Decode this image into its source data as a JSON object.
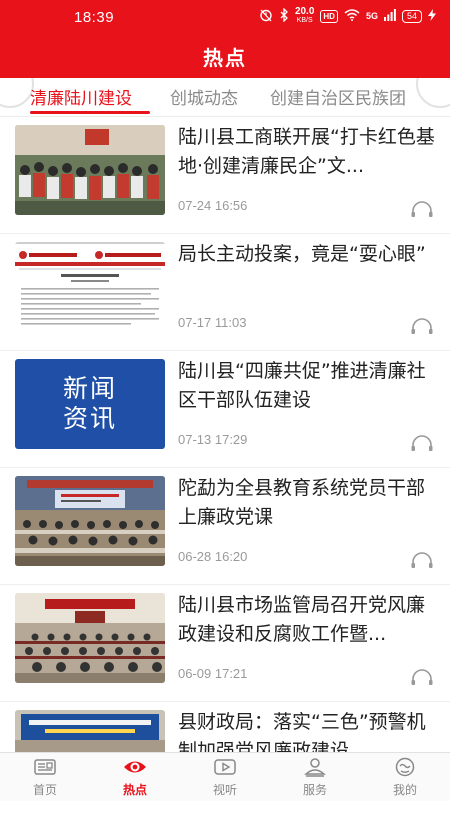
{
  "status_bar": {
    "time": "18:39",
    "net_speed": "20.0",
    "net_unit": "KB/S",
    "hd": "HD",
    "signal": "5G",
    "battery": "54"
  },
  "header": {
    "title": "热点"
  },
  "tabs": [
    {
      "label": "清廉陆川建设",
      "active": true
    },
    {
      "label": "创城动态",
      "active": false
    },
    {
      "label": "创建自治区民族团",
      "active": false
    }
  ],
  "news": [
    {
      "title": "陆川县工商联开展“打卡红色基地·创建清廉民企”文...",
      "time": "07-24 16:56",
      "thumb": "meeting-photo"
    },
    {
      "title": "局长主动投案，竟是“耍心眼”",
      "time": "07-17 11:03",
      "thumb": "document-screenshot"
    },
    {
      "title": "陆川县“四廉共促”推进清廉社区干部队伍建设",
      "time": "07-13 17:29",
      "thumb": "news-text-card",
      "thumb_text_1": "新闻",
      "thumb_text_2": "资讯"
    },
    {
      "title": "陀勐为全县教育系统党员干部上廉政党课",
      "time": "06-28 16:20",
      "thumb": "lecture-hall-photo"
    },
    {
      "title": "陆川县市场监管局召开党风廉政建设和反腐败工作暨...",
      "time": "06-09 17:21",
      "thumb": "conference-photo"
    },
    {
      "title": "县财政局：落实“三色”预警机制加强党风廉政建设",
      "time": "",
      "thumb": "stage-photo"
    }
  ],
  "bottom_nav": [
    {
      "label": "首页",
      "icon": "newspaper-icon",
      "active": false
    },
    {
      "label": "热点",
      "icon": "eye-icon",
      "active": true
    },
    {
      "label": "视听",
      "icon": "video-icon",
      "active": false
    },
    {
      "label": "服务",
      "icon": "service-icon",
      "active": false
    },
    {
      "label": "我的",
      "icon": "profile-icon",
      "active": false
    }
  ],
  "colors": {
    "brand": "#e8121b",
    "muted": "#8a8a8a",
    "text": "#222222"
  }
}
